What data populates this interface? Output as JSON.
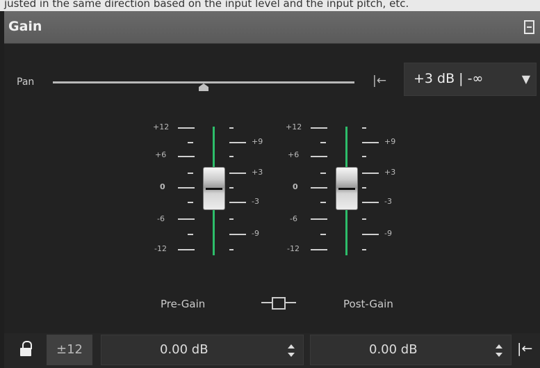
{
  "top_strip": {
    "text": "justed in the same direction based on the input level and the input pitch, etc."
  },
  "panel": {
    "title": "Gain"
  },
  "pan": {
    "label": "Pan",
    "value_fraction": 0.48
  },
  "preset": {
    "value": "+3 dB | -∞"
  },
  "faders": [
    {
      "name": "Pre-Gain",
      "left_ticks": [
        "+12",
        "+6",
        "0",
        "-6",
        "-12"
      ],
      "right_ticks": [
        "+9",
        "+3",
        "-3",
        "-9"
      ]
    },
    {
      "name": "Post-Gain",
      "left_ticks": [
        "+12",
        "+6",
        "0",
        "-6",
        "-12"
      ],
      "right_ticks": [
        "+9",
        "+3",
        "-3",
        "-9"
      ]
    }
  ],
  "bottom": {
    "range_label": "±12",
    "pre_gain_value": "0.00 dB",
    "post_gain_value": "0.00 dB"
  },
  "icons": {
    "collapse": "collapse-icon",
    "reset": "reset-to-start-icon",
    "lock": "unlock-icon",
    "link": "link-icon",
    "dropdown": "chevron-down-icon"
  },
  "colors": {
    "fader_rail": "#2dbd6a",
    "background": "#222222",
    "titlebar": "#5e5e5e"
  }
}
